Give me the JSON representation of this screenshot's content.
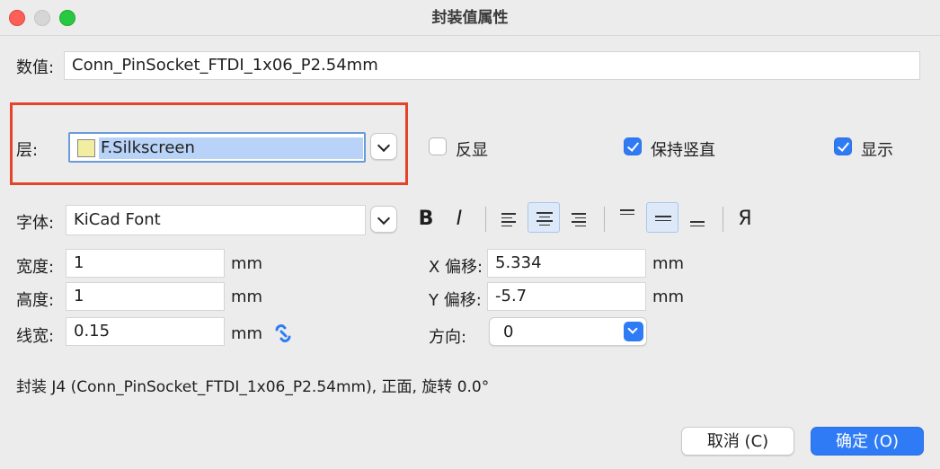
{
  "window": {
    "title": "封装值属性"
  },
  "value": {
    "label": "数值:",
    "text": "Conn_PinSocket_FTDI_1x06_P2.54mm"
  },
  "layer": {
    "label": "层:",
    "selected": "F.Silkscreen",
    "swatch_color": "#f2eda1",
    "highlight_color": "#e5432c"
  },
  "checkboxes": {
    "mirror": {
      "label": "反显",
      "checked": false
    },
    "keep_upright": {
      "label": "保持竖直",
      "checked": true
    },
    "visible": {
      "label": "显示",
      "checked": true
    }
  },
  "font": {
    "label": "字体:",
    "selected": "KiCad Font"
  },
  "toolbar": {
    "bold": "B",
    "italic": "I",
    "mirror_glyph": "Я"
  },
  "size": {
    "width_label": "宽度:",
    "width_value": "1",
    "height_label": "高度:",
    "height_value": "1",
    "thickness_label": "线宽:",
    "thickness_value": "0.15",
    "unit": "mm"
  },
  "offset": {
    "x_label": "X 偏移:",
    "x_value": "5.334",
    "y_label": "Y 偏移:",
    "y_value": "-5.7",
    "unit": "mm"
  },
  "orientation": {
    "label": "方向:",
    "selected": "0"
  },
  "info": "封装 J4 (Conn_PinSocket_FTDI_1x06_P2.54mm), 正面, 旋转 0.0°",
  "buttons": {
    "cancel": "取消 (C)",
    "ok": "确定 (O)"
  },
  "colors": {
    "accent": "#2f7bf5"
  }
}
